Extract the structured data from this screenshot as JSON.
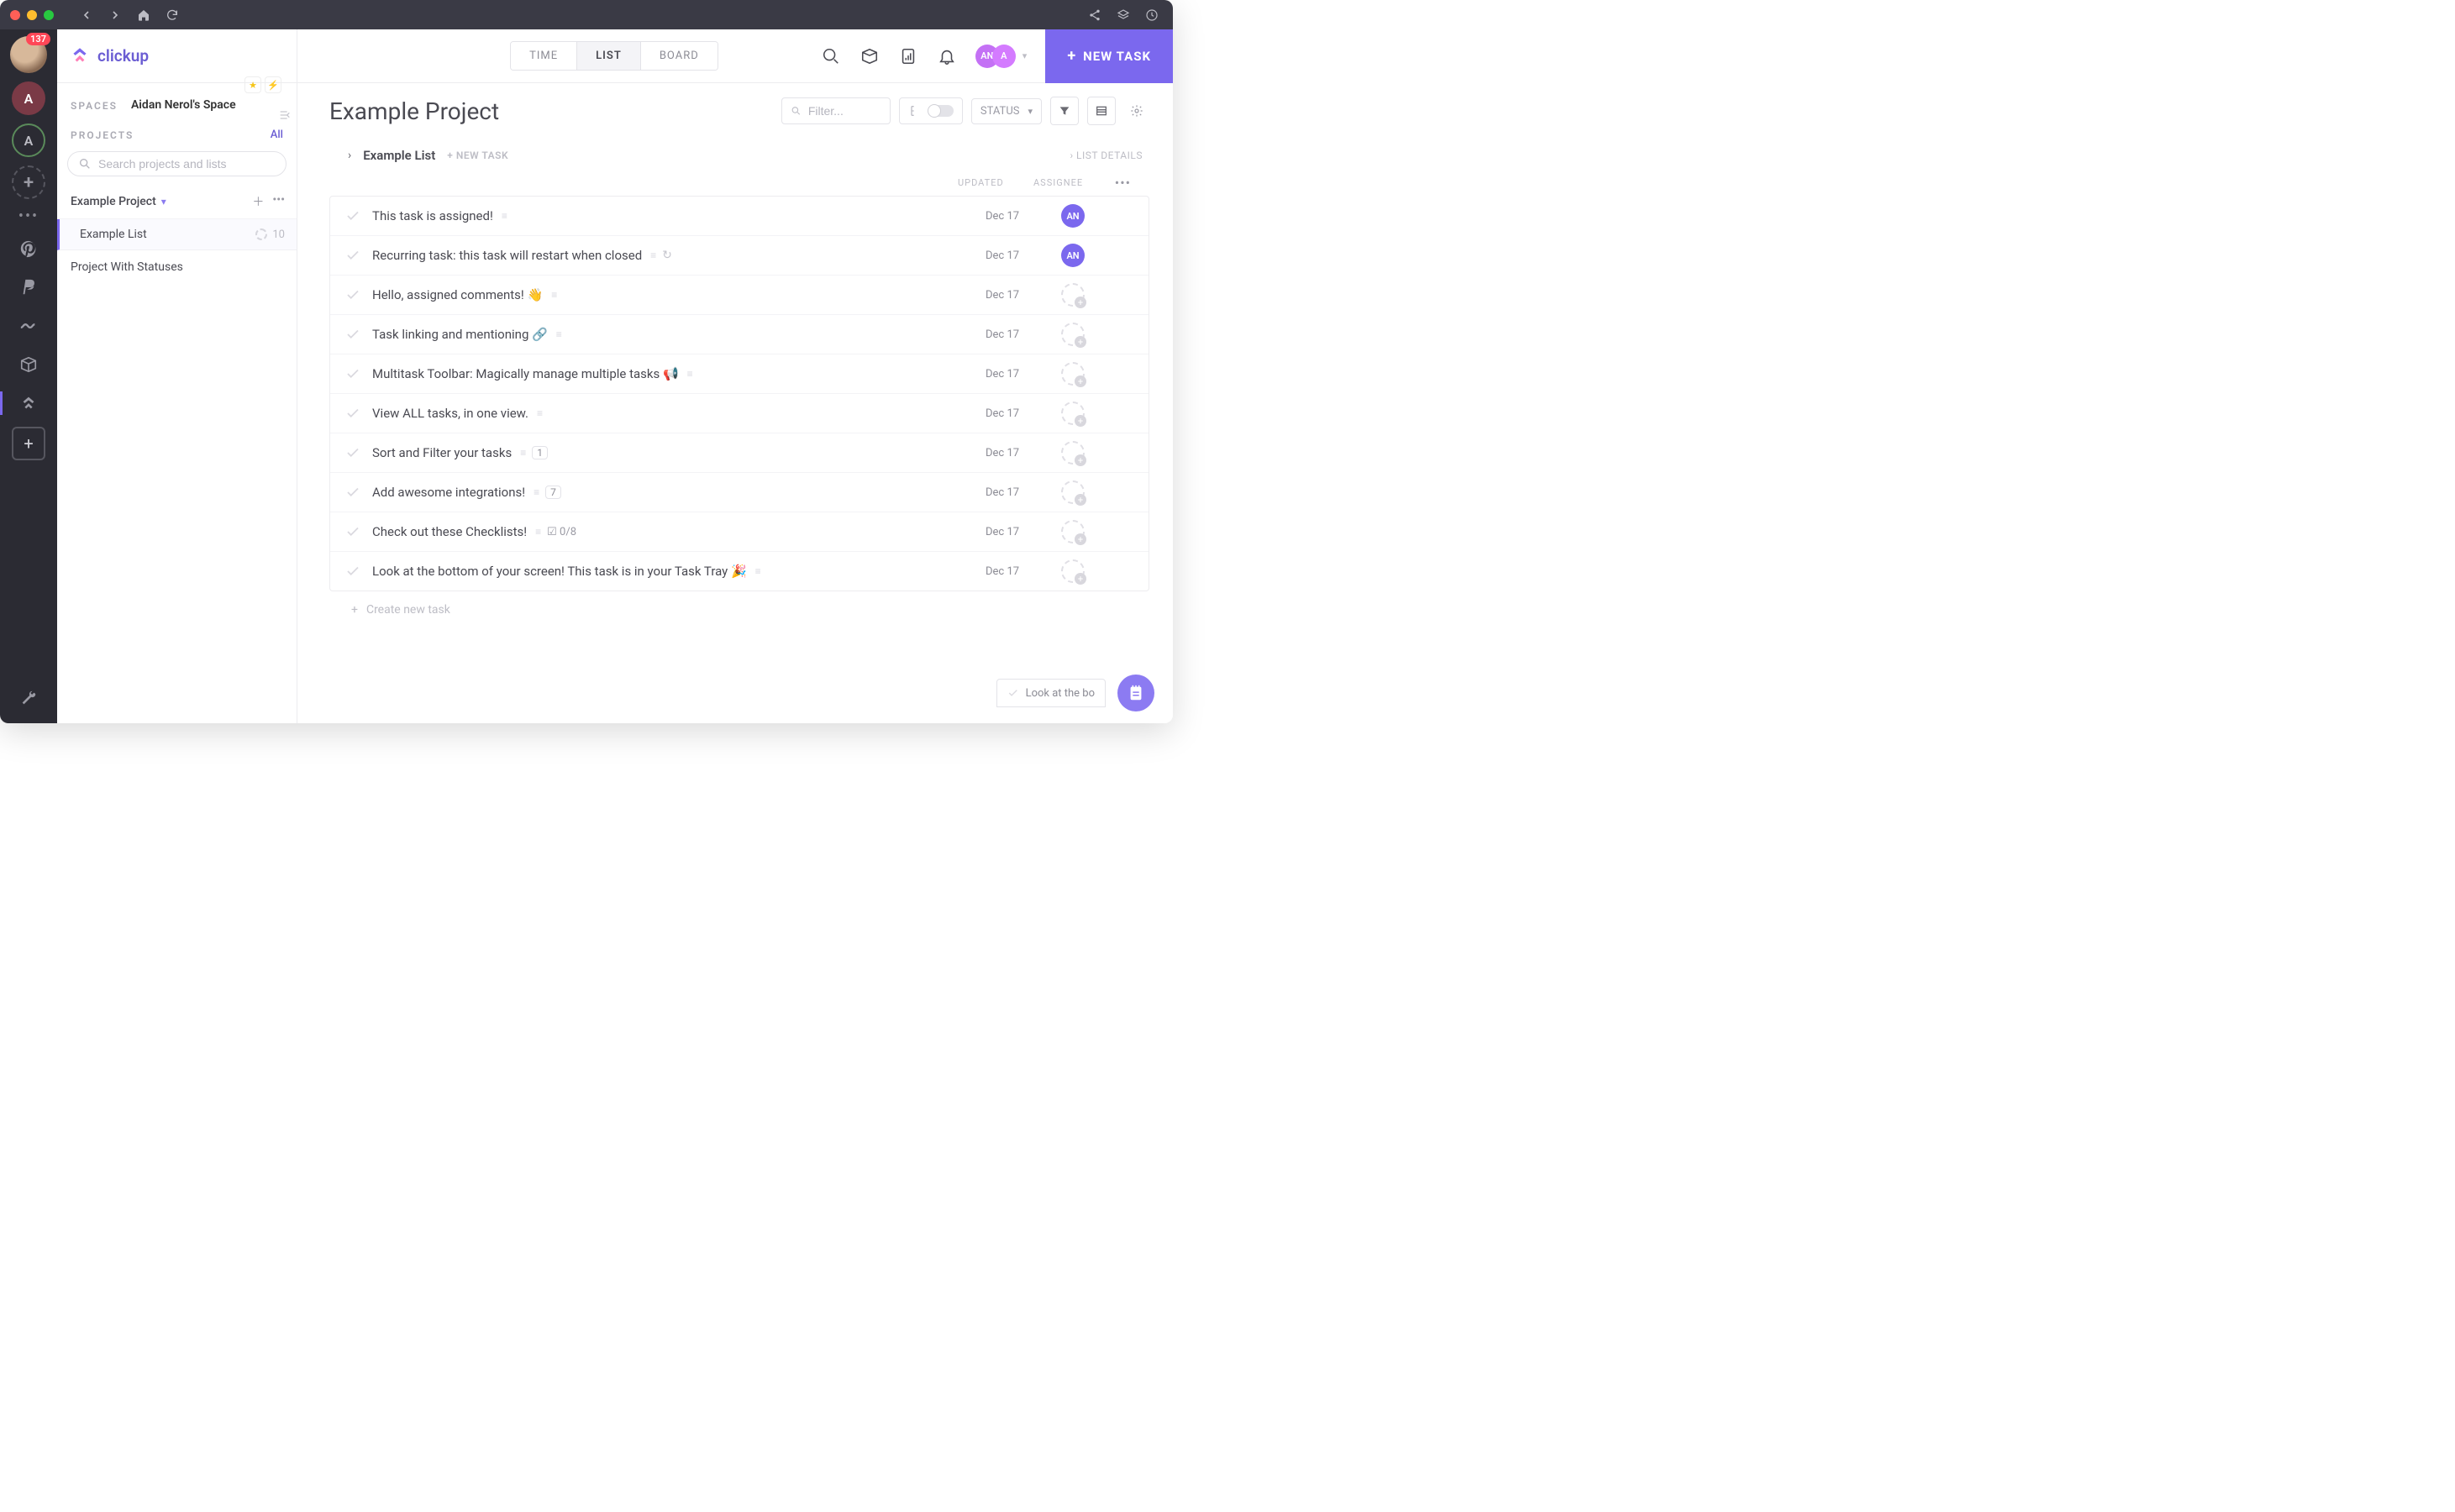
{
  "titlebar": {
    "notification_count": "137"
  },
  "brand": {
    "name": "clickup"
  },
  "leftStrip": {
    "a1": "A",
    "a2": "A"
  },
  "sidebar": {
    "spaces_label": "SPACES",
    "space_name": "Aidan Nerol's Space",
    "projects_label": "PROJECTS",
    "all_link": "All",
    "search_placeholder": "Search projects and lists",
    "project1": "Example Project",
    "list1": "Example List",
    "list1_count": "10",
    "project2": "Project With Statuses"
  },
  "tabs": {
    "time": "TIME",
    "list": "LIST",
    "board": "BOARD"
  },
  "userChip": {
    "initials1": "AN",
    "initials2": "A"
  },
  "newTaskButton": "NEW TASK",
  "page": {
    "title": "Example Project",
    "filter_placeholder": "Filter...",
    "status_label": "STATUS"
  },
  "list": {
    "name": "Example List",
    "new_task_label": "NEW TASK",
    "details_label": "LIST DETAILS"
  },
  "columns": {
    "updated": "UPDATED",
    "assignee": "ASSIGNEE"
  },
  "tasks": [
    {
      "title": "This task is assigned!",
      "updated": "Dec 17",
      "assignee": "AN",
      "icons": [
        "desc"
      ]
    },
    {
      "title": "Recurring task: this task will restart when closed",
      "updated": "Dec 17",
      "assignee": "AN",
      "icons": [
        "desc",
        "recur"
      ]
    },
    {
      "title": "Hello, assigned comments! 👋",
      "updated": "Dec 17",
      "assignee": null,
      "icons": [
        "desc"
      ]
    },
    {
      "title": "Task linking and mentioning 🔗",
      "updated": "Dec 17",
      "assignee": null,
      "icons": [
        "desc"
      ]
    },
    {
      "title": "Multitask Toolbar: Magically manage multiple tasks 📢",
      "updated": "Dec 17",
      "assignee": null,
      "icons": [
        "desc"
      ]
    },
    {
      "title": "View ALL tasks, in one view.",
      "updated": "Dec 17",
      "assignee": null,
      "icons": [
        "desc"
      ]
    },
    {
      "title": "Sort and Filter your tasks",
      "updated": "Dec 17",
      "assignee": null,
      "icons": [
        "desc"
      ],
      "count": "1"
    },
    {
      "title": "Add awesome integrations!",
      "updated": "Dec 17",
      "assignee": null,
      "icons": [
        "desc"
      ],
      "count": "7"
    },
    {
      "title": "Check out these Checklists!",
      "updated": "Dec 17",
      "assignee": null,
      "icons": [
        "desc"
      ],
      "checklist": "0/8"
    },
    {
      "title": "Look at the bottom of your screen! This task is in your Task Tray 🎉",
      "updated": "Dec 17",
      "assignee": null,
      "icons": [
        "desc"
      ]
    }
  ],
  "createNew": "Create new task",
  "tray": {
    "preview": "Look at the bo"
  }
}
